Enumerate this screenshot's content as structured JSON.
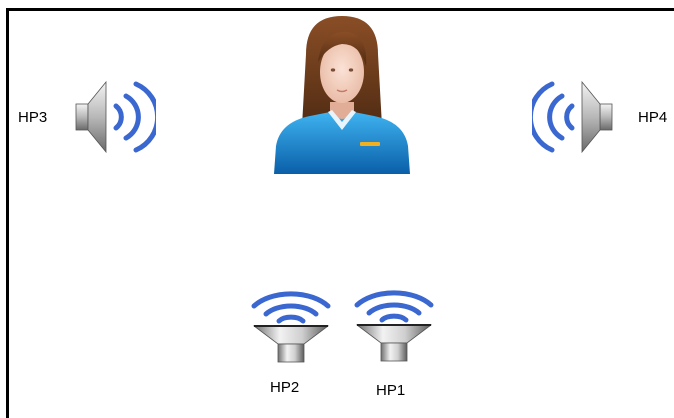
{
  "speakers": {
    "hp1": {
      "label": "HP1",
      "icon": "speaker-up-icon"
    },
    "hp2": {
      "label": "HP2",
      "icon": "speaker-up-icon"
    },
    "hp3": {
      "label": "HP3",
      "icon": "speaker-right-icon"
    },
    "hp4": {
      "label": "HP4",
      "icon": "speaker-left-icon"
    }
  },
  "listener": {
    "icon": "person-icon"
  },
  "colors": {
    "wave": "#3a68d0",
    "speaker_metal": "#a8a8a8",
    "shirt": "#1c8fd8",
    "hair": "#6a3a1c",
    "frame": "#000000"
  }
}
